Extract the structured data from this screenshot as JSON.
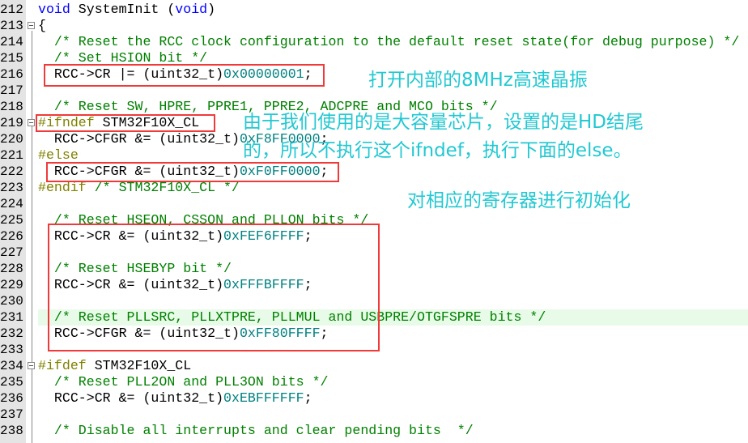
{
  "colors": {
    "keyword": "#0000ff",
    "comment": "#008000",
    "preprocessor": "#808000",
    "number": "#008080",
    "annotation": "#22c8d2",
    "highlight_box": "#f03a3a",
    "current_line": "#e8fbe8"
  },
  "lines": [
    {
      "n": "212",
      "seg": [
        [
          "kw",
          "void"
        ],
        [
          "tx",
          " SystemInit ("
        ],
        [
          "kw",
          "void"
        ],
        [
          "tx",
          ")"
        ]
      ]
    },
    {
      "n": "213",
      "fold": true,
      "seg": [
        [
          "tx",
          "{"
        ]
      ]
    },
    {
      "n": "214",
      "seg": [
        [
          "cm",
          "  /* Reset the RCC clock configuration to the default reset state(for debug purpose) */"
        ]
      ]
    },
    {
      "n": "215",
      "seg": [
        [
          "cm",
          "  /* Set HSION bit */"
        ]
      ]
    },
    {
      "n": "216",
      "seg": [
        [
          "tx",
          "  RCC->CR |= (uint32_t)"
        ],
        [
          "num",
          "0x00000001"
        ],
        [
          "tx",
          ";"
        ]
      ]
    },
    {
      "n": "217",
      "seg": []
    },
    {
      "n": "218",
      "seg": [
        [
          "cm",
          "  /* Reset SW, HPRE, PPRE1, PPRE2, ADCPRE and MCO bits */"
        ]
      ]
    },
    {
      "n": "219",
      "fold": true,
      "seg": [
        [
          "pp",
          "#ifndef"
        ],
        [
          "tx",
          " STM32F10X_CL"
        ]
      ]
    },
    {
      "n": "220",
      "seg": [
        [
          "tx",
          "  RCC->CFGR &= (uint32_t)"
        ],
        [
          "num",
          "0xF8FF0000"
        ],
        [
          "tx",
          ";"
        ]
      ]
    },
    {
      "n": "221",
      "seg": [
        [
          "pp",
          "#else"
        ]
      ]
    },
    {
      "n": "222",
      "seg": [
        [
          "tx",
          "  RCC->CFGR &= (uint32_t)"
        ],
        [
          "num",
          "0xF0FF0000"
        ],
        [
          "tx",
          ";"
        ]
      ]
    },
    {
      "n": "223",
      "seg": [
        [
          "pp",
          "#endif"
        ],
        [
          "cm",
          " /* STM32F10X_CL */"
        ]
      ]
    },
    {
      "n": "224",
      "seg": []
    },
    {
      "n": "225",
      "seg": [
        [
          "cm",
          "  /* Reset HSEON, CSSON and PLLON bits */"
        ]
      ]
    },
    {
      "n": "226",
      "seg": [
        [
          "tx",
          "  RCC->CR &= (uint32_t)"
        ],
        [
          "num",
          "0xFEF6FFFF"
        ],
        [
          "tx",
          ";"
        ]
      ]
    },
    {
      "n": "227",
      "seg": []
    },
    {
      "n": "228",
      "seg": [
        [
          "cm",
          "  /* Reset HSEBYP bit */"
        ]
      ]
    },
    {
      "n": "229",
      "seg": [
        [
          "tx",
          "  RCC->CR &= (uint32_t)"
        ],
        [
          "num",
          "0xFFFBFFFF"
        ],
        [
          "tx",
          ";"
        ]
      ]
    },
    {
      "n": "230",
      "seg": []
    },
    {
      "n": "231",
      "current": true,
      "seg": [
        [
          "cm",
          "  /* Reset PLLSRC, PLLXTPRE, PLLMUL and USBPRE/OTGFSPRE bits */"
        ]
      ]
    },
    {
      "n": "232",
      "seg": [
        [
          "tx",
          "  RCC->CFGR &= (uint32_t)"
        ],
        [
          "num",
          "0xFF80FFFF"
        ],
        [
          "tx",
          ";"
        ]
      ]
    },
    {
      "n": "233",
      "seg": []
    },
    {
      "n": "234",
      "fold": true,
      "seg": [
        [
          "pp",
          "#ifdef"
        ],
        [
          "tx",
          " STM32F10X_CL"
        ]
      ]
    },
    {
      "n": "235",
      "seg": [
        [
          "cm",
          "  /* Reset PLL2ON and PLL3ON bits */"
        ]
      ]
    },
    {
      "n": "236",
      "seg": [
        [
          "tx",
          "  RCC->CR &= (uint32_t)"
        ],
        [
          "num",
          "0xEBFFFFFF"
        ],
        [
          "tx",
          ";"
        ]
      ]
    },
    {
      "n": "237",
      "seg": []
    },
    {
      "n": "238",
      "seg": [
        [
          "cm",
          "  /* Disable all interrupts and clear pending bits  */"
        ]
      ]
    }
  ],
  "annotations": {
    "hsi": "打开内部的8MHz高速晶振",
    "ifndef_1": "由于我们使用的是大容量芯片，设置的是HD结尾",
    "ifndef_2": "的，所以不执行这个ifndef，执行下面的else。",
    "init": "对相应的寄存器进行初始化"
  }
}
